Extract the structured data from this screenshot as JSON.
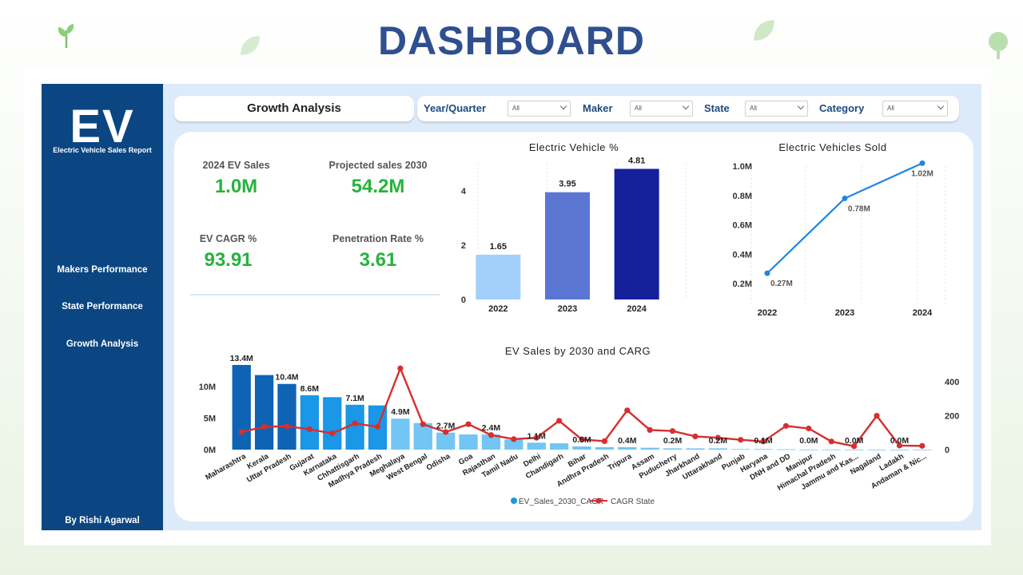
{
  "header": {
    "title": "DASHBOARD"
  },
  "sidebar": {
    "logo": "EV",
    "subtitle": "Electric Vehicle Sales Report",
    "nav": [
      {
        "label": "Makers Performance"
      },
      {
        "label": "State Performance"
      },
      {
        "label": "Growth Analysis"
      }
    ],
    "author": "By Rishi Agarwal"
  },
  "topbar": {
    "title": "Growth Analysis",
    "filters": [
      {
        "label": "Year/Quarter",
        "value": "All"
      },
      {
        "label": "Maker",
        "value": "All"
      },
      {
        "label": "State",
        "value": "All"
      },
      {
        "label": "Category",
        "value": "All"
      }
    ]
  },
  "kpis": [
    {
      "label": "2024 EV Sales",
      "value": "1.0M"
    },
    {
      "label": "Projected sales 2030",
      "value": "54.2M"
    },
    {
      "label": "EV CAGR %",
      "value": "93.91"
    },
    {
      "label": "Penetration Rate %",
      "value": "3.61"
    }
  ],
  "colors": {
    "sidebar": "#0b4682",
    "accent_green": "#27b23c",
    "line_blue": "#1f86e0",
    "line_red": "#d62f2f"
  },
  "chart_data": [
    {
      "type": "bar",
      "title": "Electric Vehicle %",
      "categories": [
        "2022",
        "2023",
        "2024"
      ],
      "values": [
        1.65,
        3.95,
        4.81
      ],
      "data_labels": [
        "1.65",
        "3.95",
        "4.81"
      ],
      "bar_colors": [
        "#a3d0fb",
        "#5b77d3",
        "#14219a"
      ],
      "y_ticks": [
        "0",
        "2",
        "4"
      ],
      "ylim": [
        0,
        5
      ],
      "grid": true
    },
    {
      "type": "line",
      "title": "Electric Vehicles Sold",
      "categories": [
        "2022",
        "2023",
        "2024"
      ],
      "values": [
        0.27,
        0.78,
        1.02
      ],
      "data_labels": [
        "0.27M",
        "0.78M",
        "1.02M"
      ],
      "y_ticks": [
        "0.2M",
        "0.4M",
        "0.6M",
        "0.8M",
        "1.0M"
      ],
      "ylim": [
        0.2,
        1.0
      ],
      "grid": true
    },
    {
      "type": "bar",
      "title": "EV Sales by 2030 and CARG",
      "categories": [
        "Maharashtra",
        "Kerala",
        "Uttar Pradesh",
        "Gujarat",
        "Karnataka",
        "Chhattisgarh",
        "Madhya Pradesh",
        "Meghalaya",
        "West Bengal",
        "Odisha",
        "Goa",
        "Rajasthan",
        "Tamil Nadu",
        "Delhi",
        "Chandigarh",
        "Bihar",
        "Andhra Pradesh",
        "Tripura",
        "Assam",
        "Puducherry",
        "Jharkhand",
        "Uttarakhand",
        "Punjab",
        "Haryana",
        "DNH and DD",
        "Manipur",
        "Himachal Pradesh",
        "Jammu and Kas...",
        "Nagaland",
        "Ladakh",
        "Andaman & Nic..."
      ],
      "series": [
        {
          "name": "EV_Sales_2030_CAGR",
          "axis": "left",
          "values": [
            13.4,
            11.8,
            10.4,
            8.6,
            8.3,
            7.1,
            7.0,
            4.9,
            4.2,
            2.7,
            2.4,
            2.4,
            1.6,
            1.1,
            1.0,
            0.5,
            0.4,
            0.4,
            0.3,
            0.2,
            0.2,
            0.2,
            0.1,
            0.1,
            0.05,
            0.03,
            0.03,
            0.02,
            0.02,
            0.01,
            0.01
          ]
        },
        {
          "name": "CAGR State",
          "axis": "right",
          "type": "line",
          "values": [
            104,
            135,
            138,
            120,
            96,
            155,
            135,
            480,
            150,
            104,
            150,
            86,
            62,
            70,
            170,
            60,
            50,
            232,
            116,
            110,
            78,
            70,
            58,
            48,
            140,
            125,
            48,
            20,
            200,
            24,
            22
          ]
        }
      ],
      "data_labels": [
        {
          "index": 0,
          "text": "13.4M"
        },
        {
          "index": 2,
          "text": "10.4M"
        },
        {
          "index": 3,
          "text": "8.6M"
        },
        {
          "index": 5,
          "text": "7.1M"
        },
        {
          "index": 7,
          "text": "4.9M"
        },
        {
          "index": 9,
          "text": "2.7M"
        },
        {
          "index": 11,
          "text": "2.4M"
        },
        {
          "index": 13,
          "text": "1.1M"
        },
        {
          "index": 15,
          "text": "0.5M"
        },
        {
          "index": 17,
          "text": "0.4M"
        },
        {
          "index": 19,
          "text": "0.2M"
        },
        {
          "index": 21,
          "text": "0.2M"
        },
        {
          "index": 23,
          "text": "0.1M"
        },
        {
          "index": 25,
          "text": "0.0M"
        },
        {
          "index": 27,
          "text": "0.0M"
        },
        {
          "index": 29,
          "text": "0.0M"
        }
      ],
      "y_ticks_left": [
        "0M",
        "5M",
        "10M"
      ],
      "y_ticks_right": [
        "0",
        "200",
        "400"
      ],
      "ylim_left": [
        0,
        13.4
      ],
      "ylim_right": [
        0,
        500
      ],
      "legend": "bottom"
    }
  ]
}
